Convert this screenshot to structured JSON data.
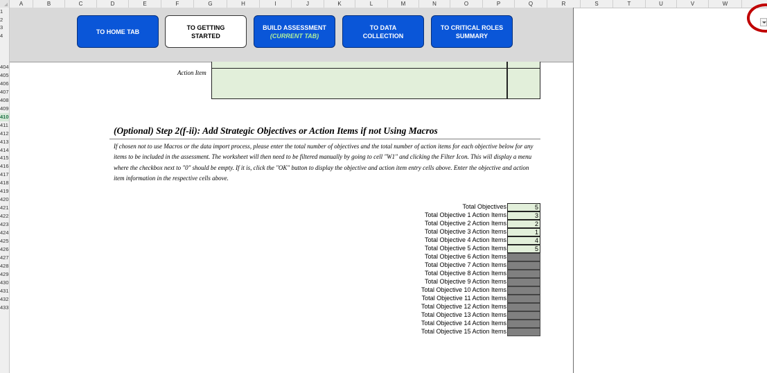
{
  "columns": [
    "A",
    "B",
    "C",
    "D",
    "E",
    "F",
    "G",
    "H",
    "I",
    "J",
    "K",
    "L",
    "M",
    "N",
    "O",
    "P",
    "Q",
    "R",
    "S",
    "T",
    "U",
    "V",
    "W"
  ],
  "rows": [
    "1",
    "2",
    "3",
    "4",
    "404",
    "405",
    "406",
    "407",
    "408",
    "409",
    "410",
    "411",
    "412",
    "413",
    "414",
    "415",
    "416",
    "417",
    "418",
    "419",
    "420",
    "421",
    "422",
    "423",
    "424",
    "425",
    "426",
    "427",
    "428",
    "429",
    "430",
    "431",
    "432",
    "433"
  ],
  "selected_row": "410",
  "nav": {
    "home": {
      "line1": "TO HOME TAB"
    },
    "getting_started": {
      "line1": "TO GETTING",
      "line2": "STARTED"
    },
    "build": {
      "line1": "BUILD ASSESSMENT",
      "line2": "(CURRENT TAB)"
    },
    "data": {
      "line1": "TO DATA",
      "line2": "COLLECTION"
    },
    "critical": {
      "line1": "TO CRITICAL ROLES",
      "line2": "SUMMARY"
    }
  },
  "action_item_label": "Action Item",
  "section": {
    "heading": "(Optional) Step 2(f-ii): Add Strategic Objectives or Action Items if not Using Macros",
    "paragraph": "If chosen not to use Macros or the data import process, please enter the total number of objectives and the total number of action items for each objective below for any items to be included in the assessment. The worksheet will then need to be filtered manually by going to cell \"W1\" and clicking the Filter Icon. This will display a menu where the checkbox next to \"0\" should be empty. If it is, click the \"OK\" button to display the objective and action item entry cells above. Enter the objective and action item information in the respective cells above."
  },
  "totals": [
    {
      "label": "Total Objectives",
      "value": "5"
    },
    {
      "label": "Total Objective 1 Action Items",
      "value": "3"
    },
    {
      "label": "Total Objective 2 Action Items",
      "value": "2"
    },
    {
      "label": "Total Objective 3 Action Items",
      "value": "1"
    },
    {
      "label": "Total Objective 4 Action Items",
      "value": "4"
    },
    {
      "label": "Total Objective 5 Action Items",
      "value": "5"
    },
    {
      "label": "Total Objective 6 Action Items",
      "value": ""
    },
    {
      "label": "Total Objective 7 Action Items",
      "value": ""
    },
    {
      "label": "Total Objective 8 Action Items",
      "value": ""
    },
    {
      "label": "Total Objective 9 Action Items",
      "value": ""
    },
    {
      "label": "Total Objective 10 Action Items",
      "value": ""
    },
    {
      "label": "Total Objective 11 Action Items",
      "value": ""
    },
    {
      "label": "Total Objective 12 Action Items",
      "value": ""
    },
    {
      "label": "Total Objective 13 Action Items",
      "value": ""
    },
    {
      "label": "Total Objective 14 Action Items",
      "value": ""
    },
    {
      "label": "Total Objective 15 Action Items",
      "value": ""
    }
  ],
  "colors": {
    "blue_button": "#0a56d8",
    "entry_green": "#e2efda",
    "disabled_gray": "#808080",
    "highlight_circle": "#c00000"
  },
  "icons": {
    "filter": "filter-dropdown-icon"
  }
}
